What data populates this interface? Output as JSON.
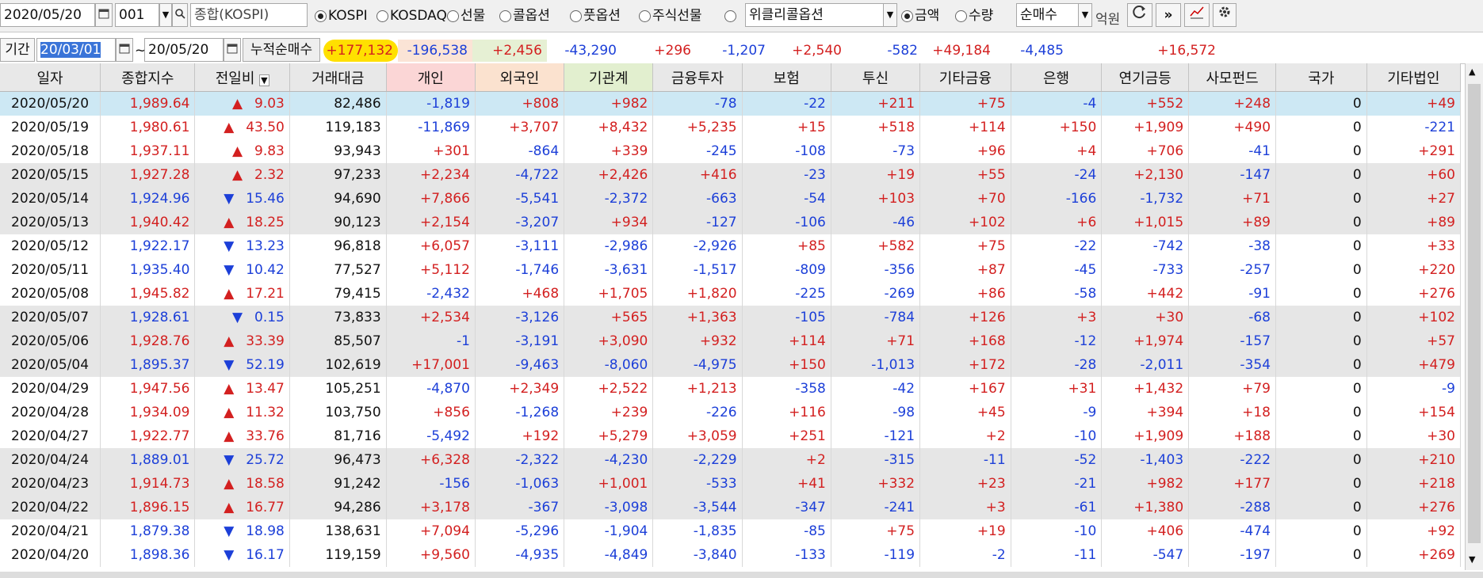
{
  "toolbar": {
    "date": "2020/05/20",
    "code": "001",
    "index_name": "종합(KOSPI)",
    "markets": [
      "KOSPI",
      "KOSDAQ",
      "선물",
      "콜옵션",
      "풋옵션",
      "주식선물",
      ""
    ],
    "weekly_option": "위클리콜옵션",
    "amount_label": "금액",
    "qty_label": "수량",
    "netbuy": "순매수",
    "unit": "억원"
  },
  "period": {
    "label": "기간",
    "from": "20/03/01",
    "to": "20/05/20",
    "cum_label": "누적순매수",
    "sums": [
      "+177,132",
      "-196,538",
      "+2,456",
      "-43,290",
      "+296",
      "-1,207",
      "+2,540",
      "-582",
      "+49,184",
      "-4,485",
      "",
      "+16,572"
    ]
  },
  "table": {
    "headers": [
      "일자",
      "종합지수",
      "전일비",
      "거래대금",
      "개인",
      "외국인",
      "기관계",
      "금융투자",
      "보험",
      "투신",
      "기타금융",
      "은행",
      "연기금등",
      "사모펀드",
      "국가",
      "기타법인"
    ],
    "rows": [
      {
        "date": "2020/05/20",
        "idx": "1,989.64",
        "dir": "up",
        "chg": "9.03",
        "vol": "82,486",
        "v": [
          "-1,819",
          "+808",
          "+982",
          "-78",
          "-22",
          "+211",
          "+75",
          "-4",
          "+552",
          "+248",
          "0",
          "+49"
        ]
      },
      {
        "date": "2020/05/19",
        "idx": "1,980.61",
        "dir": "up",
        "chg": "43.50",
        "vol": "119,183",
        "v": [
          "-11,869",
          "+3,707",
          "+8,432",
          "+5,235",
          "+15",
          "+518",
          "+114",
          "+150",
          "+1,909",
          "+490",
          "0",
          "-221"
        ]
      },
      {
        "date": "2020/05/18",
        "idx": "1,937.11",
        "dir": "up",
        "chg": "9.83",
        "vol": "93,943",
        "v": [
          "+301",
          "-864",
          "+339",
          "-245",
          "-108",
          "-73",
          "+96",
          "+4",
          "+706",
          "-41",
          "0",
          "+291"
        ]
      },
      {
        "date": "2020/05/15",
        "idx": "1,927.28",
        "dir": "up",
        "chg": "2.32",
        "vol": "97,233",
        "v": [
          "+2,234",
          "-4,722",
          "+2,426",
          "+416",
          "-23",
          "+19",
          "+55",
          "-24",
          "+2,130",
          "-147",
          "0",
          "+60"
        ]
      },
      {
        "date": "2020/05/14",
        "idx": "1,924.96",
        "dir": "down",
        "chg": "15.46",
        "vol": "94,690",
        "v": [
          "+7,866",
          "-5,541",
          "-2,372",
          "-663",
          "-54",
          "+103",
          "+70",
          "-166",
          "-1,732",
          "+71",
          "0",
          "+27"
        ]
      },
      {
        "date": "2020/05/13",
        "idx": "1,940.42",
        "dir": "up",
        "chg": "18.25",
        "vol": "90,123",
        "v": [
          "+2,154",
          "-3,207",
          "+934",
          "-127",
          "-106",
          "-46",
          "+102",
          "+6",
          "+1,015",
          "+89",
          "0",
          "+89"
        ]
      },
      {
        "date": "2020/05/12",
        "idx": "1,922.17",
        "dir": "down",
        "chg": "13.23",
        "vol": "96,818",
        "v": [
          "+6,057",
          "-3,111",
          "-2,986",
          "-2,926",
          "+85",
          "+582",
          "+75",
          "-22",
          "-742",
          "-38",
          "0",
          "+33"
        ]
      },
      {
        "date": "2020/05/11",
        "idx": "1,935.40",
        "dir": "down",
        "chg": "10.42",
        "vol": "77,527",
        "v": [
          "+5,112",
          "-1,746",
          "-3,631",
          "-1,517",
          "-809",
          "-356",
          "+87",
          "-45",
          "-733",
          "-257",
          "0",
          "+220"
        ]
      },
      {
        "date": "2020/05/08",
        "idx": "1,945.82",
        "dir": "up",
        "chg": "17.21",
        "vol": "79,415",
        "v": [
          "-2,432",
          "+468",
          "+1,705",
          "+1,820",
          "-225",
          "-269",
          "+86",
          "-58",
          "+442",
          "-91",
          "0",
          "+276"
        ]
      },
      {
        "date": "2020/05/07",
        "idx": "1,928.61",
        "dir": "down",
        "chg": "0.15",
        "vol": "73,833",
        "v": [
          "+2,534",
          "-3,126",
          "+565",
          "+1,363",
          "-105",
          "-784",
          "+126",
          "+3",
          "+30",
          "-68",
          "0",
          "+102"
        ]
      },
      {
        "date": "2020/05/06",
        "idx": "1,928.76",
        "dir": "up",
        "chg": "33.39",
        "vol": "85,507",
        "v": [
          "-1",
          "-3,191",
          "+3,090",
          "+932",
          "+114",
          "+71",
          "+168",
          "-12",
          "+1,974",
          "-157",
          "0",
          "+57"
        ]
      },
      {
        "date": "2020/05/04",
        "idx": "1,895.37",
        "dir": "down",
        "chg": "52.19",
        "vol": "102,619",
        "v": [
          "+17,001",
          "-9,463",
          "-8,060",
          "-4,975",
          "+150",
          "-1,013",
          "+172",
          "-28",
          "-2,011",
          "-354",
          "0",
          "+479"
        ]
      },
      {
        "date": "2020/04/29",
        "idx": "1,947.56",
        "dir": "up",
        "chg": "13.47",
        "vol": "105,251",
        "v": [
          "-4,870",
          "+2,349",
          "+2,522",
          "+1,213",
          "-358",
          "-42",
          "+167",
          "+31",
          "+1,432",
          "+79",
          "0",
          "-9"
        ]
      },
      {
        "date": "2020/04/28",
        "idx": "1,934.09",
        "dir": "up",
        "chg": "11.32",
        "vol": "103,750",
        "v": [
          "+856",
          "-1,268",
          "+239",
          "-226",
          "+116",
          "-98",
          "+45",
          "-9",
          "+394",
          "+18",
          "0",
          "+154"
        ]
      },
      {
        "date": "2020/04/27",
        "idx": "1,922.77",
        "dir": "up",
        "chg": "33.76",
        "vol": "81,716",
        "v": [
          "-5,492",
          "+192",
          "+5,279",
          "+3,059",
          "+251",
          "-121",
          "+2",
          "-10",
          "+1,909",
          "+188",
          "0",
          "+30"
        ]
      },
      {
        "date": "2020/04/24",
        "idx": "1,889.01",
        "dir": "down",
        "chg": "25.72",
        "vol": "96,473",
        "v": [
          "+6,328",
          "-2,322",
          "-4,230",
          "-2,229",
          "+2",
          "-315",
          "-11",
          "-52",
          "-1,403",
          "-222",
          "0",
          "+210"
        ]
      },
      {
        "date": "2020/04/23",
        "idx": "1,914.73",
        "dir": "up",
        "chg": "18.58",
        "vol": "91,242",
        "v": [
          "-156",
          "-1,063",
          "+1,001",
          "-533",
          "+41",
          "+332",
          "+23",
          "-21",
          "+982",
          "+177",
          "0",
          "+218"
        ]
      },
      {
        "date": "2020/04/22",
        "idx": "1,896.15",
        "dir": "up",
        "chg": "16.77",
        "vol": "94,286",
        "v": [
          "+3,178",
          "-367",
          "-3,098",
          "-3,544",
          "-347",
          "-241",
          "+3",
          "-61",
          "+1,380",
          "-288",
          "0",
          "+276"
        ]
      },
      {
        "date": "2020/04/21",
        "idx": "1,879.38",
        "dir": "down",
        "chg": "18.98",
        "vol": "138,631",
        "v": [
          "+7,094",
          "-5,296",
          "-1,904",
          "-1,835",
          "-85",
          "+75",
          "+19",
          "-10",
          "+406",
          "-474",
          "0",
          "+92"
        ]
      },
      {
        "date": "2020/04/20",
        "idx": "1,898.36",
        "dir": "down",
        "chg": "16.17",
        "vol": "119,159",
        "v": [
          "+9,560",
          "-4,935",
          "-4,849",
          "-3,840",
          "-133",
          "-119",
          "-2",
          "-11",
          "-547",
          "-197",
          "0",
          "+269"
        ]
      }
    ]
  },
  "colors": {
    "up": "#d32020",
    "down": "#1c3fd8",
    "selected_row": "#cde8f4",
    "group_row": "#e6e6e6",
    "highlight": "#ffe000"
  },
  "icons": [
    "calendar-icon",
    "dropdown-icon",
    "search-icon",
    "refresh-icon",
    "forward-icon",
    "chart-icon",
    "gear-icon",
    "scroll-up-icon",
    "scroll-down-icon"
  ]
}
